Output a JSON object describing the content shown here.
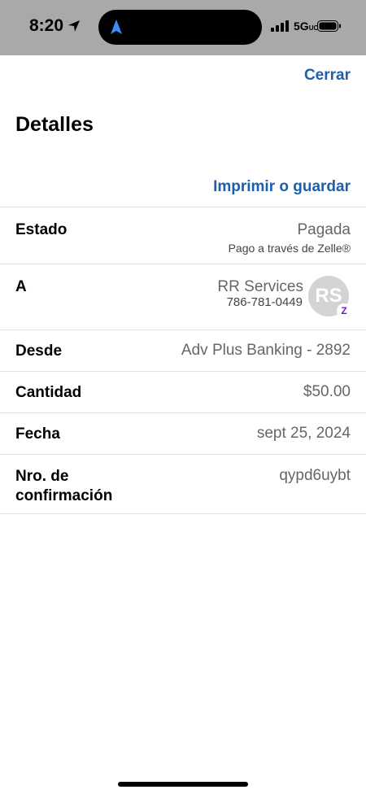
{
  "status_bar": {
    "time": "8:20",
    "network": "5G",
    "network_suffix": "UC"
  },
  "header": {
    "close_label": "Cerrar",
    "title": "Detalles",
    "print_label": "Imprimir o guardar"
  },
  "details": {
    "estado": {
      "label": "Estado",
      "value": "Pagada",
      "sub": "Pago a través de Zelle®"
    },
    "a": {
      "label": "A",
      "name": "RR Services",
      "phone": "786-781-0449",
      "initials": "RS",
      "badge": "Z"
    },
    "desde": {
      "label": "Desde",
      "value": "Adv Plus Banking - 2892"
    },
    "cantidad": {
      "label": "Cantidad",
      "value": "$50.00"
    },
    "fecha": {
      "label": "Fecha",
      "value": "sept 25, 2024"
    },
    "confirmacion": {
      "label_line1": "Nro. de",
      "label_line2": "confirmación",
      "value": "qypd6uybt"
    }
  },
  "colors": {
    "accent": "#1d5fae",
    "zelle": "#6d1ed4",
    "status_bar_bg": "#a9a9a9"
  }
}
